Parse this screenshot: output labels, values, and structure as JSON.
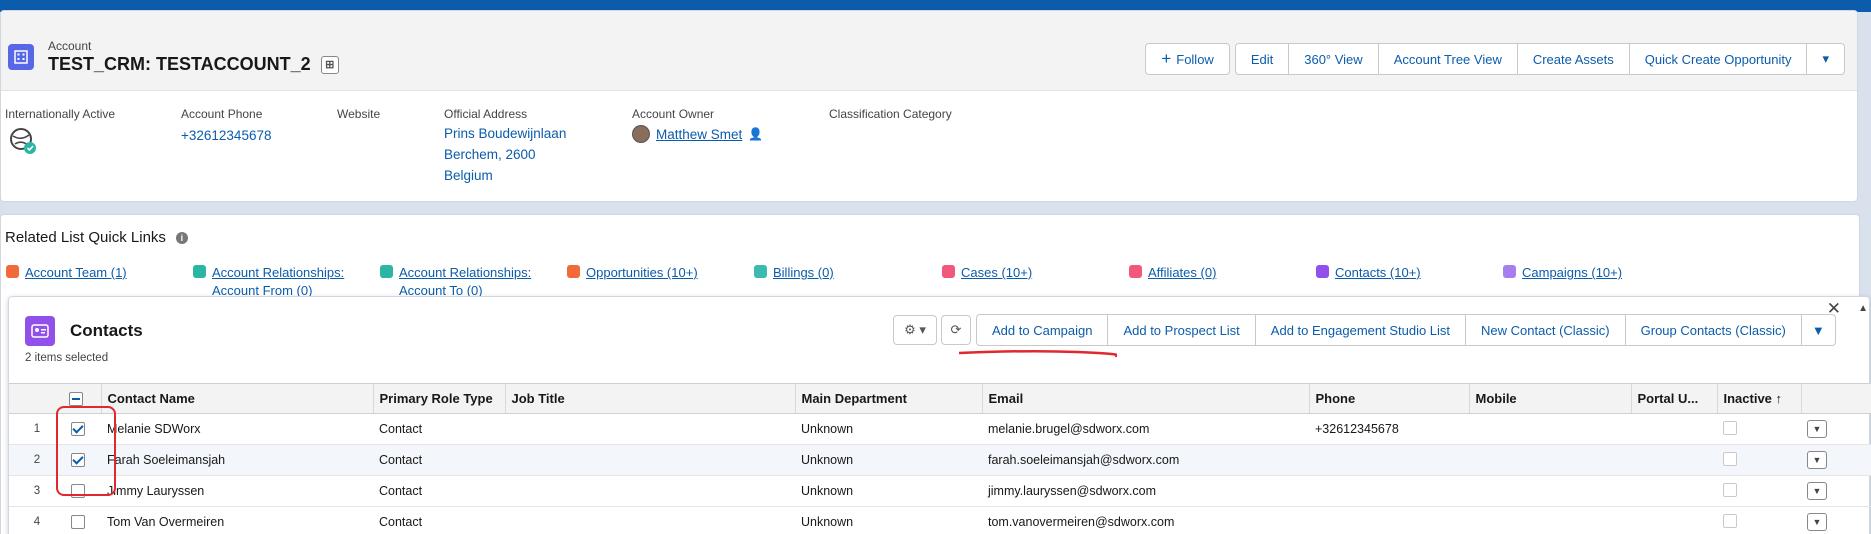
{
  "header": {
    "object_label": "Account",
    "title": "TEST_CRM: TESTACCOUNT_2",
    "buttons": [
      "Edit",
      "360° View",
      "Account Tree View",
      "Create Assets",
      "Quick Create Opportunity"
    ],
    "follow_label": "Follow"
  },
  "fields": {
    "intl_label": "Internationally Active",
    "phone_label": "Account Phone",
    "phone_value": "+32612345678",
    "website_label": "Website",
    "address_label": "Official Address",
    "address_line1": "Prins Boudewijnlaan",
    "address_line2": "Berchem, 2600",
    "address_line3": "Belgium",
    "owner_label": "Account Owner",
    "owner_value": "Matthew Smet",
    "class_label": "Classification Category"
  },
  "quick_links": {
    "title": "Related List Quick Links",
    "items": [
      {
        "label": "Account Team (1)",
        "color": "#f26a3a"
      },
      {
        "label": "Account Relationships: Account From (0)",
        "color": "#2bb5a4"
      },
      {
        "label": "Account Relationships: Account To (0)",
        "color": "#2bb5a4"
      },
      {
        "label": "Opportunities (10+)",
        "color": "#f26a3a"
      },
      {
        "label": "Billings (0)",
        "color": "#3bbab0"
      },
      {
        "label": "Cases (10+)",
        "color": "#f2587a"
      },
      {
        "label": "Affiliates (0)",
        "color": "#f2587a"
      },
      {
        "label": "Contacts (10+)",
        "color": "#9050e9"
      },
      {
        "label": "Campaigns (10+)",
        "color": "#a67ef0"
      }
    ]
  },
  "contacts": {
    "title": "Contacts",
    "selected_text": "2 items selected",
    "buttons": [
      "Add to Campaign",
      "Add to Prospect List",
      "Add to Engagement Studio List",
      "New Contact (Classic)",
      "Group Contacts (Classic)"
    ],
    "columns": [
      "Contact Name",
      "Primary Role Type",
      "Job Title",
      "Main Department",
      "Email",
      "Phone",
      "Mobile",
      "Portal U...",
      "Inactive ↑"
    ],
    "rows": [
      {
        "num": "1",
        "name": "Melanie SDWorx",
        "role": "Contact",
        "job": "",
        "dept": "Unknown",
        "email": "melanie.brugel@sdworx.com",
        "phone": "+32612345678",
        "mobile": ""
      },
      {
        "num": "2",
        "name": "Farah Soeleimansjah",
        "role": "Contact",
        "job": "",
        "dept": "Unknown",
        "email": "farah.soeleimansjah@sdworx.com",
        "phone": "",
        "mobile": ""
      },
      {
        "num": "3",
        "name": "Jimmy Lauryssen",
        "role": "Contact",
        "job": "",
        "dept": "Unknown",
        "email": "jimmy.lauryssen@sdworx.com",
        "phone": "",
        "mobile": ""
      },
      {
        "num": "4",
        "name": "Tom Van Overmeiren",
        "role": "Contact",
        "job": "",
        "dept": "Unknown",
        "email": "tom.vanovermeiren@sdworx.com",
        "phone": "",
        "mobile": ""
      }
    ],
    "selected": [
      true,
      true,
      false,
      false
    ]
  },
  "colors": {
    "accent": "#0b5cab",
    "annotation": "#e0282e"
  }
}
